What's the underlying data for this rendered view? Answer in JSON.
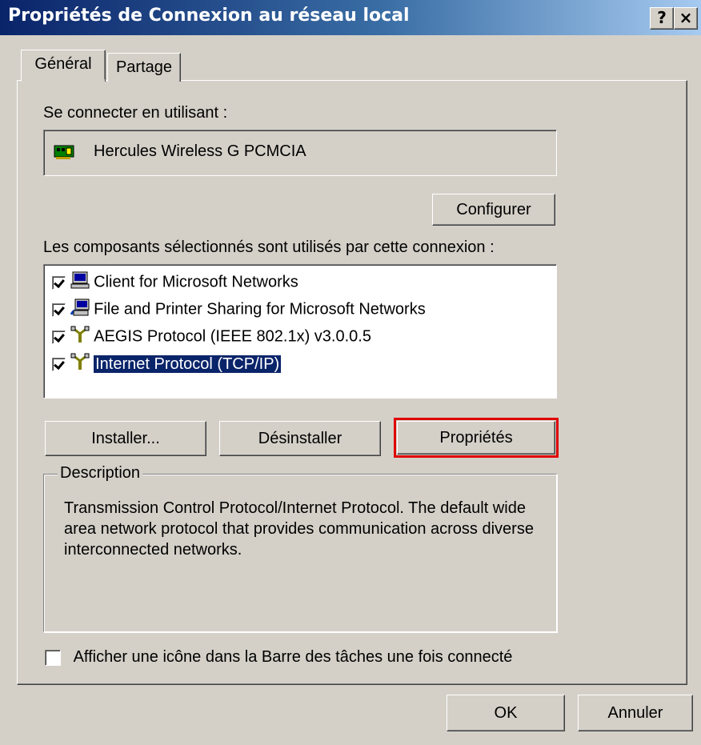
{
  "window": {
    "title": "Propriétés de Connexion au réseau local",
    "help_button": "?",
    "close_button": "×"
  },
  "tabs": [
    {
      "label": "Général",
      "active": true
    },
    {
      "label": "Partage",
      "active": false
    }
  ],
  "connect": {
    "label": "Se connecter en utilisant :",
    "adapter": "Hercules Wireless G PCMCIA",
    "configure_button": "Configurer"
  },
  "components": {
    "label": "Les composants sélectionnés sont utilisés par cette connexion :",
    "items": [
      {
        "label": "Client for Microsoft Networks",
        "checked": true,
        "icon": "network-client-icon"
      },
      {
        "label": "File and Printer Sharing for Microsoft Networks",
        "checked": true,
        "icon": "file-printer-sharing-icon"
      },
      {
        "label": "AEGIS Protocol (IEEE 802.1x) v3.0.0.5",
        "checked": true,
        "icon": "protocol-icon"
      },
      {
        "label": "Internet Protocol (TCP/IP)",
        "checked": true,
        "selected": true,
        "icon": "protocol-icon"
      }
    ]
  },
  "actions": {
    "install": "Installer...",
    "uninstall": "Désinstaller",
    "properties": "Propriétés"
  },
  "description": {
    "legend": "Description",
    "text": "Transmission Control Protocol/Internet Protocol. The default wide area network protocol that provides communication across diverse interconnected networks."
  },
  "taskbar_option": {
    "label": "Afficher une icône dans la Barre des tâches une fois connecté",
    "checked": false
  },
  "footer": {
    "ok": "OK",
    "cancel": "Annuler"
  },
  "colors": {
    "titlebar_start": "#0a246a",
    "titlebar_end": "#a6caf0",
    "face": "#d4d0c8",
    "selection": "#0a246a",
    "highlight_box": "#e00000"
  }
}
